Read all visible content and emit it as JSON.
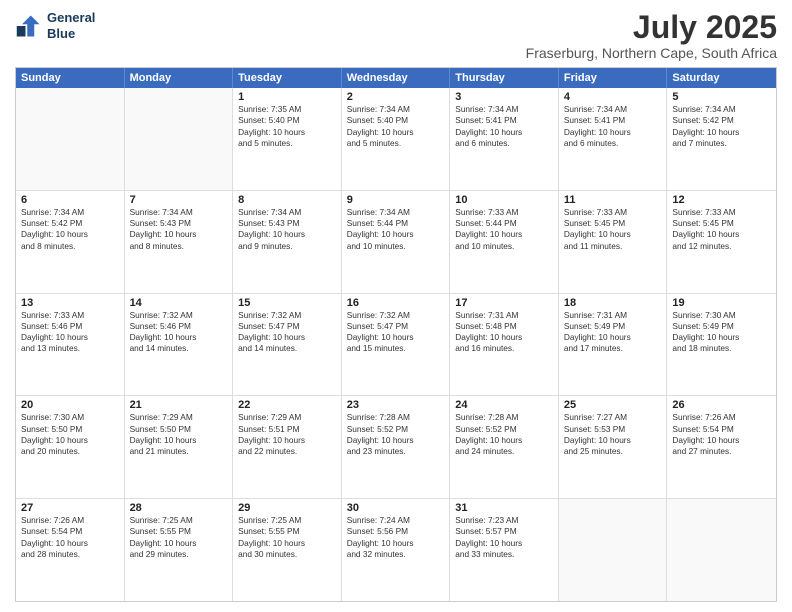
{
  "logo": {
    "line1": "General",
    "line2": "Blue"
  },
  "title": "July 2025",
  "subtitle": "Fraserburg, Northern Cape, South Africa",
  "header_days": [
    "Sunday",
    "Monday",
    "Tuesday",
    "Wednesday",
    "Thursday",
    "Friday",
    "Saturday"
  ],
  "rows": [
    [
      {
        "day": "",
        "info": ""
      },
      {
        "day": "",
        "info": ""
      },
      {
        "day": "1",
        "info": "Sunrise: 7:35 AM\nSunset: 5:40 PM\nDaylight: 10 hours\nand 5 minutes."
      },
      {
        "day": "2",
        "info": "Sunrise: 7:34 AM\nSunset: 5:40 PM\nDaylight: 10 hours\nand 5 minutes."
      },
      {
        "day": "3",
        "info": "Sunrise: 7:34 AM\nSunset: 5:41 PM\nDaylight: 10 hours\nand 6 minutes."
      },
      {
        "day": "4",
        "info": "Sunrise: 7:34 AM\nSunset: 5:41 PM\nDaylight: 10 hours\nand 6 minutes."
      },
      {
        "day": "5",
        "info": "Sunrise: 7:34 AM\nSunset: 5:42 PM\nDaylight: 10 hours\nand 7 minutes."
      }
    ],
    [
      {
        "day": "6",
        "info": "Sunrise: 7:34 AM\nSunset: 5:42 PM\nDaylight: 10 hours\nand 8 minutes."
      },
      {
        "day": "7",
        "info": "Sunrise: 7:34 AM\nSunset: 5:43 PM\nDaylight: 10 hours\nand 8 minutes."
      },
      {
        "day": "8",
        "info": "Sunrise: 7:34 AM\nSunset: 5:43 PM\nDaylight: 10 hours\nand 9 minutes."
      },
      {
        "day": "9",
        "info": "Sunrise: 7:34 AM\nSunset: 5:44 PM\nDaylight: 10 hours\nand 10 minutes."
      },
      {
        "day": "10",
        "info": "Sunrise: 7:33 AM\nSunset: 5:44 PM\nDaylight: 10 hours\nand 10 minutes."
      },
      {
        "day": "11",
        "info": "Sunrise: 7:33 AM\nSunset: 5:45 PM\nDaylight: 10 hours\nand 11 minutes."
      },
      {
        "day": "12",
        "info": "Sunrise: 7:33 AM\nSunset: 5:45 PM\nDaylight: 10 hours\nand 12 minutes."
      }
    ],
    [
      {
        "day": "13",
        "info": "Sunrise: 7:33 AM\nSunset: 5:46 PM\nDaylight: 10 hours\nand 13 minutes."
      },
      {
        "day": "14",
        "info": "Sunrise: 7:32 AM\nSunset: 5:46 PM\nDaylight: 10 hours\nand 14 minutes."
      },
      {
        "day": "15",
        "info": "Sunrise: 7:32 AM\nSunset: 5:47 PM\nDaylight: 10 hours\nand 14 minutes."
      },
      {
        "day": "16",
        "info": "Sunrise: 7:32 AM\nSunset: 5:47 PM\nDaylight: 10 hours\nand 15 minutes."
      },
      {
        "day": "17",
        "info": "Sunrise: 7:31 AM\nSunset: 5:48 PM\nDaylight: 10 hours\nand 16 minutes."
      },
      {
        "day": "18",
        "info": "Sunrise: 7:31 AM\nSunset: 5:49 PM\nDaylight: 10 hours\nand 17 minutes."
      },
      {
        "day": "19",
        "info": "Sunrise: 7:30 AM\nSunset: 5:49 PM\nDaylight: 10 hours\nand 18 minutes."
      }
    ],
    [
      {
        "day": "20",
        "info": "Sunrise: 7:30 AM\nSunset: 5:50 PM\nDaylight: 10 hours\nand 20 minutes."
      },
      {
        "day": "21",
        "info": "Sunrise: 7:29 AM\nSunset: 5:50 PM\nDaylight: 10 hours\nand 21 minutes."
      },
      {
        "day": "22",
        "info": "Sunrise: 7:29 AM\nSunset: 5:51 PM\nDaylight: 10 hours\nand 22 minutes."
      },
      {
        "day": "23",
        "info": "Sunrise: 7:28 AM\nSunset: 5:52 PM\nDaylight: 10 hours\nand 23 minutes."
      },
      {
        "day": "24",
        "info": "Sunrise: 7:28 AM\nSunset: 5:52 PM\nDaylight: 10 hours\nand 24 minutes."
      },
      {
        "day": "25",
        "info": "Sunrise: 7:27 AM\nSunset: 5:53 PM\nDaylight: 10 hours\nand 25 minutes."
      },
      {
        "day": "26",
        "info": "Sunrise: 7:26 AM\nSunset: 5:54 PM\nDaylight: 10 hours\nand 27 minutes."
      }
    ],
    [
      {
        "day": "27",
        "info": "Sunrise: 7:26 AM\nSunset: 5:54 PM\nDaylight: 10 hours\nand 28 minutes."
      },
      {
        "day": "28",
        "info": "Sunrise: 7:25 AM\nSunset: 5:55 PM\nDaylight: 10 hours\nand 29 minutes."
      },
      {
        "day": "29",
        "info": "Sunrise: 7:25 AM\nSunset: 5:55 PM\nDaylight: 10 hours\nand 30 minutes."
      },
      {
        "day": "30",
        "info": "Sunrise: 7:24 AM\nSunset: 5:56 PM\nDaylight: 10 hours\nand 32 minutes."
      },
      {
        "day": "31",
        "info": "Sunrise: 7:23 AM\nSunset: 5:57 PM\nDaylight: 10 hours\nand 33 minutes."
      },
      {
        "day": "",
        "info": ""
      },
      {
        "day": "",
        "info": ""
      }
    ]
  ]
}
